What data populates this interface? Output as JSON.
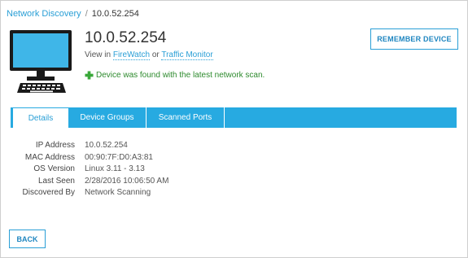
{
  "breadcrumb": {
    "root_label": "Network Discovery",
    "separator": "/",
    "current": "10.0.52.254"
  },
  "device": {
    "icon": "desktop-computer-icon",
    "ip_title": "10.0.52.254",
    "view_in_prefix": "View in",
    "firewatch_link": "FireWatch",
    "or_text": "or",
    "traffic_monitor_link": "Traffic Monitor",
    "status_icon": "green-plus-icon",
    "status_message": "Device was found with the latest network scan.",
    "remember_button": "REMEMBER DEVICE"
  },
  "tabs": [
    {
      "label": "Details",
      "active": true
    },
    {
      "label": "Device Groups",
      "active": false
    },
    {
      "label": "Scanned Ports",
      "active": false
    }
  ],
  "details": [
    {
      "label": "IP Address",
      "value": "10.0.52.254"
    },
    {
      "label": "MAC Address",
      "value": "00:90:7F:D0:A3:81"
    },
    {
      "label": "OS Version",
      "value": "Linux 3.11 - 3.13"
    },
    {
      "label": "Last Seen",
      "value": "2/28/2016 10:06:50 AM"
    },
    {
      "label": "Discovered By",
      "value": "Network Scanning"
    }
  ],
  "back_button": "BACK",
  "colors": {
    "accent": "#27aae1",
    "link": "#2a9fd6",
    "success": "#2d8a2d",
    "monitor_screen": "#3fb6e8"
  }
}
